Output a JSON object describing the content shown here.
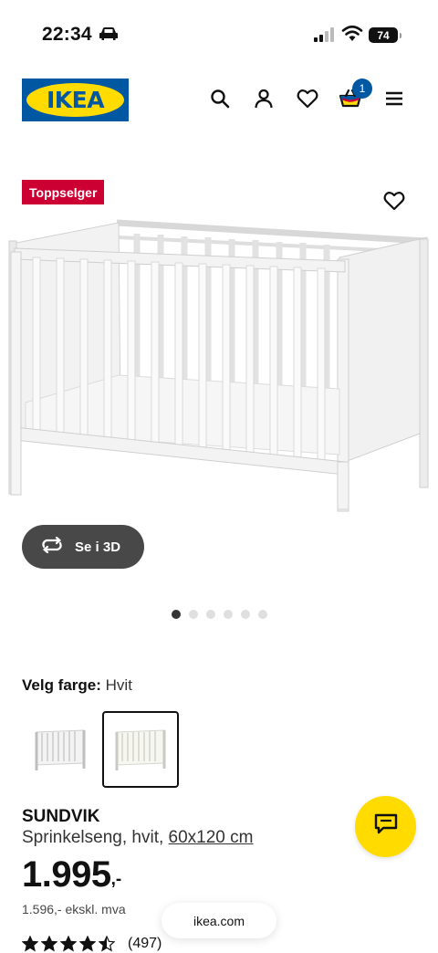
{
  "status_bar": {
    "time": "22:34",
    "battery": "74"
  },
  "header": {
    "logo_text": "IKEA",
    "cart_count": "1",
    "icons": [
      "search-icon",
      "user-icon",
      "heart-icon",
      "basket-icon",
      "menu-icon"
    ]
  },
  "product": {
    "badge": "Toppselger",
    "view_3d_label": "Se i 3D",
    "carousel": {
      "total": 6,
      "active": 0
    },
    "colour": {
      "label": "Velg farge:",
      "value": "Hvit",
      "selected_swatch": 1
    },
    "name": "SUNDVIK",
    "description": "Sprinkelseng, hvit,",
    "size": "60x120 cm",
    "price": "1.995",
    "price_suffix": ",-",
    "price_ex_vat": "1.596,- ekskl. mva",
    "rating": 4.5,
    "reviews": "(497)"
  },
  "browser": {
    "url": "ikea.com"
  },
  "colors": {
    "ikea_blue": "#0058a3",
    "ikea_yellow": "#ffdb00",
    "badge_red": "#cc0033"
  }
}
